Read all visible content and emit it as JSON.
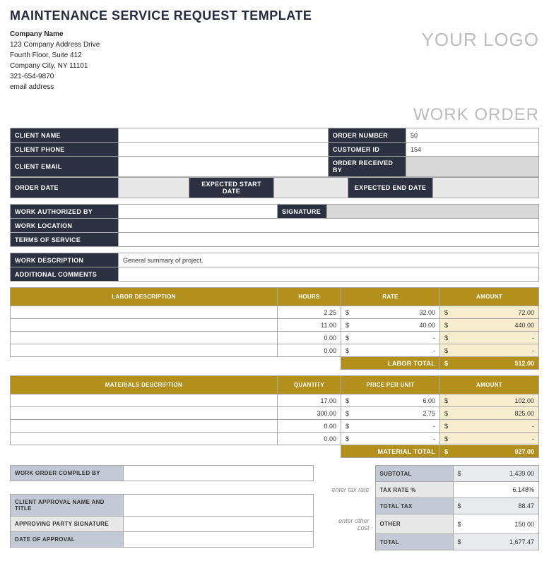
{
  "title": "MAINTENANCE SERVICE REQUEST TEMPLATE",
  "company": {
    "name": "Company Name",
    "addr1": "123 Company Address Drive",
    "addr2": "Fourth Floor, Suite 412",
    "city": "Company City, NY  11101",
    "phone": "321-654-9870",
    "email": "email address"
  },
  "logo": "YOUR LOGO",
  "work_order": "WORK ORDER",
  "labels": {
    "client_name": "CLIENT NAME",
    "client_phone": "CLIENT PHONE",
    "client_email": "CLIENT EMAIL",
    "order_number": "ORDER NUMBER",
    "customer_id": "CUSTOMER ID",
    "order_received_by": "ORDER RECEIVED BY",
    "order_date": "ORDER DATE",
    "expected_start": "EXPECTED START DATE",
    "expected_end": "EXPECTED END DATE",
    "work_auth": "WORK AUTHORIZED BY",
    "signature": "SIGNATURE",
    "work_location": "WORK LOCATION",
    "terms": "TERMS OF SERVICE",
    "work_desc": "WORK DESCRIPTION",
    "add_comments": "ADDITIONAL COMMENTS",
    "labor_desc": "LABOR DESCRIPTION",
    "hours": "HOURS",
    "rate": "RATE",
    "amount": "AMOUNT",
    "labor_total": "LABOR TOTAL",
    "materials_desc": "MATERIALS DESCRIPTION",
    "quantity": "QUANTITY",
    "ppu": "PRICE PER UNIT",
    "material_total": "MATERIAL TOTAL",
    "compiled_by": "WORK ORDER COMPILED BY",
    "client_approval": "CLIENT APPROVAL NAME AND TITLE",
    "approving_sig": "APPROVING PARTY SIGNATURE",
    "date_approval": "DATE OF APPROVAL",
    "subtotal": "SUBTOTAL",
    "tax_rate": "TAX RATE %",
    "total_tax": "TOTAL TAX",
    "other": "OTHER",
    "total": "TOTAL",
    "enter_tax": "enter tax rate",
    "enter_other": "enter other cost"
  },
  "values": {
    "order_number": "50",
    "customer_id": "154",
    "work_desc": "General summary of project."
  },
  "labor": [
    {
      "hours": "2.25",
      "rate": "32.00",
      "amount": "72.00"
    },
    {
      "hours": "11.00",
      "rate": "40.00",
      "amount": "440.00"
    },
    {
      "hours": "0.00",
      "rate": "-",
      "amount": "-"
    },
    {
      "hours": "0.00",
      "rate": "-",
      "amount": "-"
    }
  ],
  "labor_total": "512.00",
  "materials": [
    {
      "qty": "17.00",
      "price": "6.00",
      "amount": "102.00"
    },
    {
      "qty": "300.00",
      "price": "2.75",
      "amount": "825.00"
    },
    {
      "qty": "0.00",
      "price": "-",
      "amount": "-"
    },
    {
      "qty": "0.00",
      "price": "-",
      "amount": "-"
    }
  ],
  "material_total": "927.00",
  "summary": {
    "subtotal": "1,439.00",
    "tax_rate": "6.148%",
    "total_tax": "88.47",
    "other": "150.00",
    "total": "1,677.47"
  },
  "cur": "$"
}
